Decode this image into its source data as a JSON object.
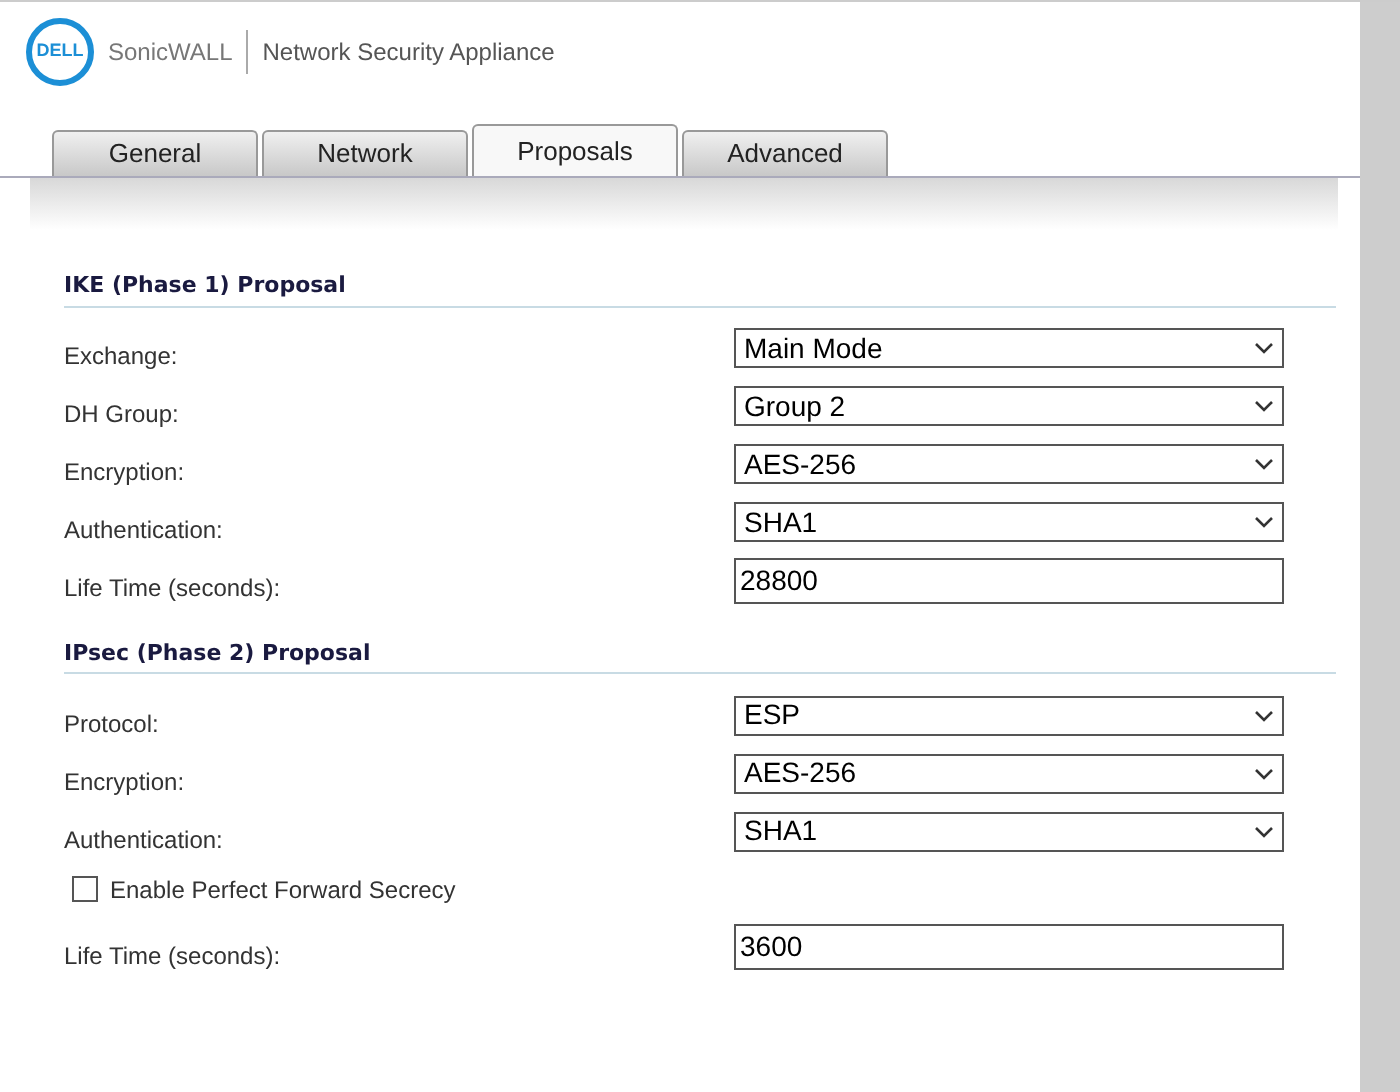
{
  "header": {
    "logo": "DELL",
    "brand": "SonicWALL",
    "product": "Network Security Appliance"
  },
  "tabs": [
    {
      "label": "General",
      "selected": false
    },
    {
      "label": "Network",
      "selected": false
    },
    {
      "label": "Proposals",
      "selected": true
    },
    {
      "label": "Advanced",
      "selected": false
    }
  ],
  "sections": [
    {
      "title": "IKE (Phase 1) Proposal",
      "rows": [
        {
          "kind": "select",
          "label": "Exchange:",
          "value": "Main Mode"
        },
        {
          "kind": "select",
          "label": "DH Group:",
          "value": "Group 2"
        },
        {
          "kind": "select",
          "label": "Encryption:",
          "value": "AES-256"
        },
        {
          "kind": "select",
          "label": "Authentication:",
          "value": "SHA1"
        },
        {
          "kind": "text",
          "label": "Life Time (seconds):",
          "value": "28800"
        }
      ]
    },
    {
      "title": "IPsec (Phase 2) Proposal",
      "rows": [
        {
          "kind": "select",
          "label": "Protocol:",
          "value": "ESP"
        },
        {
          "kind": "select",
          "label": "Encryption:",
          "value": "AES-256"
        },
        {
          "kind": "select",
          "label": "Authentication:",
          "value": "SHA1"
        },
        {
          "kind": "checkbox",
          "label": "Enable Perfect Forward Secrecy",
          "checked": false
        },
        {
          "kind": "text",
          "label": "Life Time (seconds):",
          "value": "3600"
        }
      ]
    }
  ]
}
